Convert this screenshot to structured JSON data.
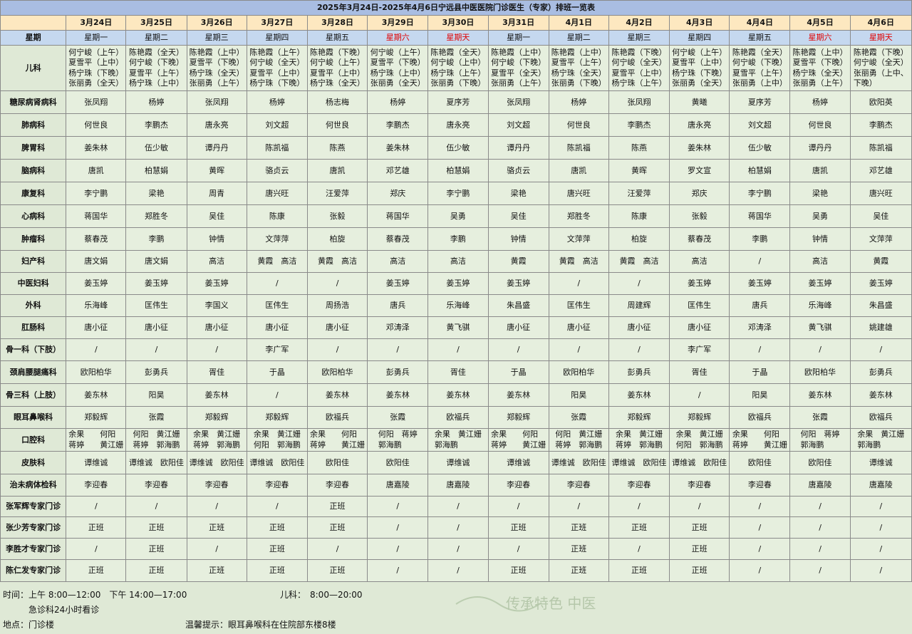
{
  "title": "2025年3月24日-2025年4月6日宁远县中医医院门诊医生（专家）排班一览表",
  "week_label": "星期",
  "dates": [
    "3月24日",
    "3月25日",
    "3月26日",
    "3月27日",
    "3月28日",
    "3月29日",
    "3月30日",
    "3月31日",
    "4月1日",
    "4月2日",
    "4月3日",
    "4月4日",
    "4月5日",
    "4月6日"
  ],
  "weekdays": [
    "星期一",
    "星期二",
    "星期三",
    "星期四",
    "星期五",
    "星期六",
    "星期天",
    "星期一",
    "星期二",
    "星期三",
    "星期四",
    "星期五",
    "星期六",
    "星期天"
  ],
  "weekend_color": "#e00000",
  "rows": [
    {
      "dept": "儿科",
      "h": 64,
      "cells": [
        [
          "何宁峻（上午）",
          "夏雪平（上中）",
          "杨宁珠（下晚）",
          "张丽勇（全天）"
        ],
        [
          "陈艳霞（全天）",
          "何宁峻（下晚）",
          "夏雪平（上午）",
          "杨宁珠（上中）"
        ],
        [
          "陈艳霞（上中）",
          "夏雪平（下晚）",
          "杨宁珠（全天）",
          "张丽勇（上午）"
        ],
        [
          "陈艳霞（上午）",
          "何宁峻（全天）",
          "夏雪平（上中）",
          "杨宁珠（下晚）"
        ],
        [
          "陈艳霞（下晚）",
          "何宁峻（上午）",
          "夏雪平（上中）",
          "杨宁珠（全天）"
        ],
        [
          "何宁峻（上午）",
          "夏雪平（下晚）",
          "杨宁珠（上中）",
          "张丽勇（全天）"
        ],
        [
          "陈艳霞（全天）",
          "何宁峻（上中）",
          "杨宁珠（上午）",
          "张丽勇（下晚）"
        ],
        [
          "陈艳霞（上中）",
          "何宁峻（下晚）",
          "夏雪平（全天）",
          "张丽勇（上午）"
        ],
        [
          "陈艳霞（上中）",
          "夏雪平（上午）",
          "杨宁珠（全天）",
          "张丽勇（下晚）"
        ],
        [
          "陈艳霞（下晚）",
          "何宁峻（全天）",
          "夏雪平（上中）",
          "杨宁珠（上午）"
        ],
        [
          "何宁峻（上午）",
          "夏雪平（上中）",
          "杨宁珠（下晚）",
          "张丽勇（全天）"
        ],
        [
          "陈艳霞（全天）",
          "何宁峻（下晚）",
          "夏雪平（上午）",
          "张丽勇（上中）"
        ],
        [
          "陈艳霞（上中）",
          "夏雪平（下晚）",
          "杨宁珠（全天）",
          "张丽勇（上午）"
        ],
        [
          "陈艳霞（下晚）",
          "何宁峻（全天）",
          "张丽勇（上中、",
          "下晚）"
        ]
      ]
    },
    {
      "dept": "糖尿病肾病科",
      "h": 32,
      "cells": [
        [
          "张凤翔"
        ],
        [
          "杨婷"
        ],
        [
          "张凤翔"
        ],
        [
          "杨婷"
        ],
        [
          "杨志梅"
        ],
        [
          "杨婷"
        ],
        [
          "夏序芳"
        ],
        [
          "张凤翔"
        ],
        [
          "杨婷"
        ],
        [
          "张凤翔"
        ],
        [
          "黄曦"
        ],
        [
          "夏序芳"
        ],
        [
          "杨婷"
        ],
        [
          "欧阳英"
        ]
      ]
    },
    {
      "dept": "肺病科",
      "h": 32,
      "cells": [
        [
          "何世良"
        ],
        [
          "李鹏杰"
        ],
        [
          "唐永亮"
        ],
        [
          "刘文超"
        ],
        [
          "何世良"
        ],
        [
          "李鹏杰"
        ],
        [
          "唐永亮"
        ],
        [
          "刘文超"
        ],
        [
          "何世良"
        ],
        [
          "李鹏杰"
        ],
        [
          "唐永亮"
        ],
        [
          "刘文超"
        ],
        [
          "何世良"
        ],
        [
          "李鹏杰"
        ]
      ]
    },
    {
      "dept": "脾胃科",
      "h": 32,
      "cells": [
        [
          "姜朱林"
        ],
        [
          "伍少敏"
        ],
        [
          "谭丹丹"
        ],
        [
          "陈凯福"
        ],
        [
          "陈燕"
        ],
        [
          "姜朱林"
        ],
        [
          "伍少敏"
        ],
        [
          "谭丹丹"
        ],
        [
          "陈凯福"
        ],
        [
          "陈燕"
        ],
        [
          "姜朱林"
        ],
        [
          "伍少敏"
        ],
        [
          "谭丹丹"
        ],
        [
          "陈凯福"
        ]
      ]
    },
    {
      "dept": "脑病科",
      "h": 32,
      "cells": [
        [
          "唐凯"
        ],
        [
          "柏慧娟"
        ],
        [
          "黄晖"
        ],
        [
          "骆贞云"
        ],
        [
          "唐凯"
        ],
        [
          "邓艺雄"
        ],
        [
          "柏慧娟"
        ],
        [
          "骆贞云"
        ],
        [
          "唐凯"
        ],
        [
          "黄晖"
        ],
        [
          "罗文宣"
        ],
        [
          "柏慧娟"
        ],
        [
          "唐凯"
        ],
        [
          "邓艺雄"
        ]
      ]
    },
    {
      "dept": "康复科",
      "h": 32,
      "cells": [
        [
          "李宁鹏"
        ],
        [
          "梁艳"
        ],
        [
          "周青"
        ],
        [
          "唐兴旺"
        ],
        [
          "汪爱萍"
        ],
        [
          "郑庆"
        ],
        [
          "李宁鹏"
        ],
        [
          "梁艳"
        ],
        [
          "唐兴旺"
        ],
        [
          "汪爱萍"
        ],
        [
          "郑庆"
        ],
        [
          "李宁鹏"
        ],
        [
          "梁艳"
        ],
        [
          "唐兴旺"
        ]
      ]
    },
    {
      "dept": "心病科",
      "h": 32,
      "cells": [
        [
          "蒋国华"
        ],
        [
          "郑胜冬"
        ],
        [
          "吴佳"
        ],
        [
          "陈康"
        ],
        [
          "张毅"
        ],
        [
          "蒋国华"
        ],
        [
          "吴勇"
        ],
        [
          "吴佳"
        ],
        [
          "郑胜冬"
        ],
        [
          "陈康"
        ],
        [
          "张毅"
        ],
        [
          "蒋国华"
        ],
        [
          "吴勇"
        ],
        [
          "吴佳"
        ]
      ]
    },
    {
      "dept": "肿瘤科",
      "h": 32,
      "cells": [
        [
          "蔡春茂"
        ],
        [
          "李鹏"
        ],
        [
          "钟情"
        ],
        [
          "文萍萍"
        ],
        [
          "柏旋"
        ],
        [
          "蔡春茂"
        ],
        [
          "李鹏"
        ],
        [
          "钟情"
        ],
        [
          "文萍萍"
        ],
        [
          "柏旋"
        ],
        [
          "蔡春茂"
        ],
        [
          "李鹏"
        ],
        [
          "钟情"
        ],
        [
          "文萍萍"
        ]
      ]
    },
    {
      "dept": "妇产科",
      "h": 31,
      "cells": [
        [
          "唐文娟"
        ],
        [
          "唐文娟"
        ],
        [
          "高洁"
        ],
        [
          "黄霞　高洁"
        ],
        [
          "黄霞　高洁"
        ],
        [
          "高洁"
        ],
        [
          "高洁"
        ],
        [
          "黄霞"
        ],
        [
          "黄霞　高洁"
        ],
        [
          "黄霞　高洁"
        ],
        [
          "高洁"
        ],
        [
          "/"
        ],
        [
          "高洁"
        ],
        [
          "黄霞"
        ]
      ]
    },
    {
      "dept": "中医妇科",
      "h": 31,
      "cells": [
        [
          "姜玉婷"
        ],
        [
          "姜玉婷"
        ],
        [
          "姜玉婷"
        ],
        [
          "/"
        ],
        [
          "/"
        ],
        [
          "姜玉婷"
        ],
        [
          "姜玉婷"
        ],
        [
          "姜玉婷"
        ],
        [
          "/"
        ],
        [
          "/"
        ],
        [
          "姜玉婷"
        ],
        [
          "姜玉婷"
        ],
        [
          "姜玉婷"
        ],
        [
          "姜玉婷"
        ]
      ]
    },
    {
      "dept": "外科",
      "h": 31,
      "cells": [
        [
          "乐海峰"
        ],
        [
          "匡伟生"
        ],
        [
          "李国义"
        ],
        [
          "匡伟生"
        ],
        [
          "周扬浩"
        ],
        [
          "唐兵"
        ],
        [
          "乐海峰"
        ],
        [
          "朱昌盛"
        ],
        [
          "匡伟生"
        ],
        [
          "周建辉"
        ],
        [
          "匡伟生"
        ],
        [
          "唐兵"
        ],
        [
          "乐海峰"
        ],
        [
          "朱昌盛"
        ]
      ]
    },
    {
      "dept": "肛肠科",
      "h": 31,
      "cells": [
        [
          "唐小征"
        ],
        [
          "唐小征"
        ],
        [
          "唐小征"
        ],
        [
          "唐小征"
        ],
        [
          "唐小征"
        ],
        [
          "邓涛泽"
        ],
        [
          "黄飞骐"
        ],
        [
          "唐小征"
        ],
        [
          "唐小征"
        ],
        [
          "唐小征"
        ],
        [
          "唐小征"
        ],
        [
          "邓涛泽"
        ],
        [
          "黄飞骐"
        ],
        [
          "姚建雄"
        ]
      ]
    },
    {
      "dept": "骨一科（下肢）",
      "h": 31,
      "cells": [
        [
          "/"
        ],
        [
          "/"
        ],
        [
          "/"
        ],
        [
          "李广军"
        ],
        [
          "/"
        ],
        [
          "/"
        ],
        [
          "/"
        ],
        [
          "/"
        ],
        [
          "/"
        ],
        [
          "/"
        ],
        [
          "李广军"
        ],
        [
          "/"
        ],
        [
          "/"
        ],
        [
          "/"
        ]
      ]
    },
    {
      "dept": "颈肩腰腿痛科",
      "h": 32,
      "cells": [
        [
          "欧阳柏华"
        ],
        [
          "彭勇兵"
        ],
        [
          "胥佳"
        ],
        [
          "于晶"
        ],
        [
          "欧阳柏华"
        ],
        [
          "彭勇兵"
        ],
        [
          "胥佳"
        ],
        [
          "于晶"
        ],
        [
          "欧阳柏华"
        ],
        [
          "彭勇兵"
        ],
        [
          "胥佳"
        ],
        [
          "于晶"
        ],
        [
          "欧阳柏华"
        ],
        [
          "彭勇兵"
        ]
      ]
    },
    {
      "dept": "骨三科（上肢）",
      "h": 32,
      "cells": [
        [
          "姜东林"
        ],
        [
          "阳昊"
        ],
        [
          "姜东林"
        ],
        [
          "/"
        ],
        [
          "姜东林"
        ],
        [
          "姜东林"
        ],
        [
          "姜东林"
        ],
        [
          "姜东林"
        ],
        [
          "阳昊"
        ],
        [
          "姜东林"
        ],
        [
          "/"
        ],
        [
          "阳昊"
        ],
        [
          "姜东林"
        ],
        [
          "姜东林"
        ]
      ]
    },
    {
      "dept": "眼耳鼻喉科",
      "h": 31,
      "cells": [
        [
          "郑毅辉"
        ],
        [
          "张霞"
        ],
        [
          "郑毅辉"
        ],
        [
          "郑毅辉"
        ],
        [
          "欧福兵"
        ],
        [
          "张霞"
        ],
        [
          "欧福兵"
        ],
        [
          "郑毅辉"
        ],
        [
          "张霞"
        ],
        [
          "郑毅辉"
        ],
        [
          "郑毅辉"
        ],
        [
          "欧福兵"
        ],
        [
          "张霞"
        ],
        [
          "欧福兵"
        ]
      ]
    },
    {
      "dept": "口腔科",
      "h": 32,
      "cells": [
        [
          "余果　　何阳",
          "蒋婷　　黄江姗"
        ],
        [
          "何阳　黄江姗",
          "蒋婷　郭海鹏"
        ],
        [
          "余果　黄江姗",
          "蒋婷　郭海鹏"
        ],
        [
          "余果　黄江姗",
          "何阳　郭海鹏"
        ],
        [
          "余果　　何阳",
          "蒋婷　　黄江姗"
        ],
        [
          "何阳　蒋婷",
          "郭海鹏"
        ],
        [
          "余果　黄江姗",
          "郭海鹏"
        ],
        [
          "余果　　何阳",
          "蒋婷　　黄江姗"
        ],
        [
          "何阳　黄江姗",
          "蒋婷　郭海鹏"
        ],
        [
          "余果　黄江姗",
          "蒋婷　郭海鹏"
        ],
        [
          "余果　黄江姗",
          "何阳　郭海鹏"
        ],
        [
          "余果　　何阳",
          "蒋婷　　黄江姗"
        ],
        [
          "何阳　蒋婷",
          "郭海鹏"
        ],
        [
          "余果　黄江姗",
          "郭海鹏"
        ]
      ]
    },
    {
      "dept": "皮肤科",
      "h": 32,
      "cells": [
        [
          "谭维诚"
        ],
        [
          "谭维诚　欧阳佳"
        ],
        [
          "谭维诚　欧阳佳"
        ],
        [
          "谭维诚　欧阳佳"
        ],
        [
          "欧阳佳"
        ],
        [
          "欧阳佳"
        ],
        [
          "谭维诚"
        ],
        [
          "谭维诚"
        ],
        [
          "谭维诚　欧阳佳"
        ],
        [
          "谭维诚　欧阳佳"
        ],
        [
          "谭维诚　欧阳佳"
        ],
        [
          "欧阳佳"
        ],
        [
          "欧阳佳"
        ],
        [
          "谭维诚"
        ]
      ]
    },
    {
      "dept": "治未病体检科",
      "h": 31,
      "cells": [
        [
          "李迎春"
        ],
        [
          "李迎春"
        ],
        [
          "李迎春"
        ],
        [
          "李迎春"
        ],
        [
          "李迎春"
        ],
        [
          "唐嘉陵"
        ],
        [
          "唐嘉陵"
        ],
        [
          "李迎春"
        ],
        [
          "李迎春"
        ],
        [
          "李迎春"
        ],
        [
          "李迎春"
        ],
        [
          "李迎春"
        ],
        [
          "唐嘉陵"
        ],
        [
          "唐嘉陵"
        ]
      ]
    },
    {
      "dept": "张军辉专家门诊",
      "h": 29,
      "cells": [
        [
          "/"
        ],
        [
          "/"
        ],
        [
          "/"
        ],
        [
          "/"
        ],
        [
          "正班"
        ],
        [
          "/"
        ],
        [
          "/"
        ],
        [
          "/"
        ],
        [
          "/"
        ],
        [
          "/"
        ],
        [
          "/"
        ],
        [
          "/"
        ],
        [
          "/"
        ],
        [
          "/"
        ]
      ]
    },
    {
      "dept": "张少芳专家门诊",
      "h": 30,
      "cells": [
        [
          "正班"
        ],
        [
          "正班"
        ],
        [
          "正班"
        ],
        [
          "正班"
        ],
        [
          "正班"
        ],
        [
          "/"
        ],
        [
          "/"
        ],
        [
          "正班"
        ],
        [
          "正班"
        ],
        [
          "正班"
        ],
        [
          "正班"
        ],
        [
          "/"
        ],
        [
          "/"
        ],
        [
          "/"
        ]
      ]
    },
    {
      "dept": "李胜才专家门诊",
      "h": 30,
      "cells": [
        [
          "/"
        ],
        [
          "正班"
        ],
        [
          "/"
        ],
        [
          "正班"
        ],
        [
          "/"
        ],
        [
          "/"
        ],
        [
          "/"
        ],
        [
          "/"
        ],
        [
          "正班"
        ],
        [
          "/"
        ],
        [
          "正班"
        ],
        [
          "/"
        ],
        [
          "/"
        ],
        [
          "/"
        ]
      ]
    },
    {
      "dept": "陈仁发专家门诊",
      "h": 31,
      "cells": [
        [
          "正班"
        ],
        [
          "正班"
        ],
        [
          "正班"
        ],
        [
          "正班"
        ],
        [
          "正班"
        ],
        [
          "/"
        ],
        [
          "/"
        ],
        [
          "正班"
        ],
        [
          "正班"
        ],
        [
          "正班"
        ],
        [
          "正班"
        ],
        [
          "/"
        ],
        [
          "/"
        ],
        [
          "/"
        ]
      ]
    }
  ],
  "footer": {
    "time": "时间：上午 8:00—12:00　下午 14:00—17:00",
    "pediatrics": "儿科：　8:00—20:00",
    "emergency": "急诊科24小时看诊",
    "location": "地点：门诊楼",
    "tip": "温馨提示：眼耳鼻喉科在住院部东楼8楼"
  },
  "watermark_text": "传承特色 中医"
}
